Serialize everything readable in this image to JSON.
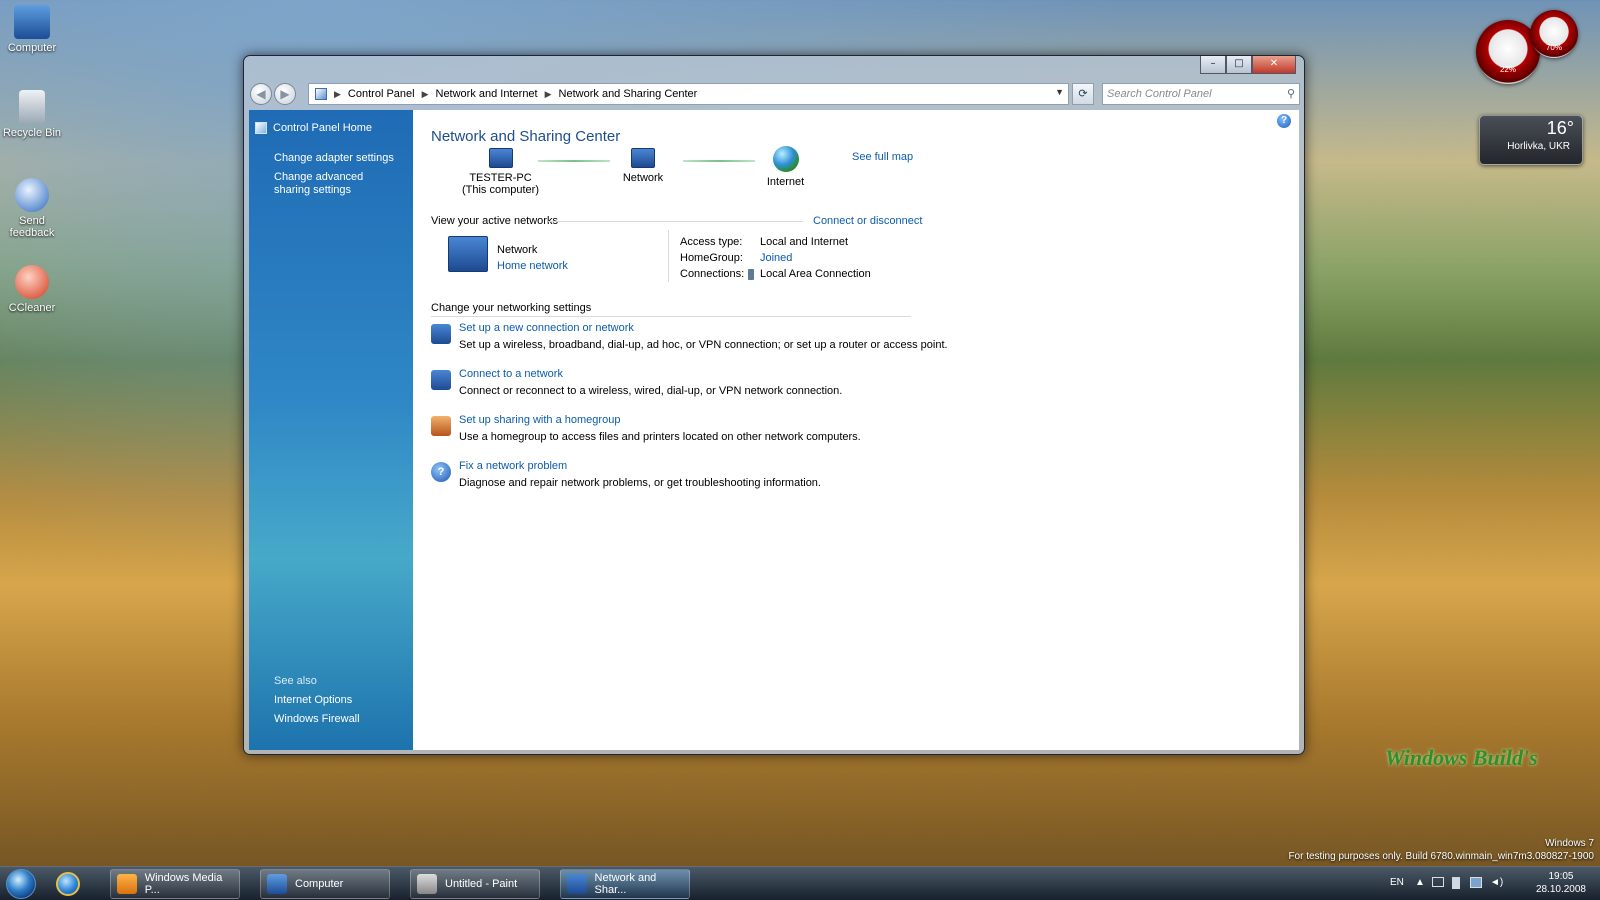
{
  "desktop": {
    "icons": [
      "Computer",
      "Recycle Bin",
      "Send feedback",
      "CCleaner"
    ],
    "meter_cpu": "22%",
    "meter_mem": "70%",
    "weather_temp": "16°",
    "weather_city": "Horlivka, UKR",
    "watermark_line1": "Windows 7",
    "watermark_line2": "For testing purposes only. Build 6780.winmain_win7m3.080827-1900",
    "brand_text": "Windows Build's"
  },
  "window": {
    "breadcrumb": [
      "Control Panel",
      "Network and Internet",
      "Network and Sharing Center"
    ],
    "search_placeholder": "Search Control Panel",
    "sidebar": {
      "home": "Control Panel Home",
      "links": [
        "Change adapter settings",
        "Change advanced sharing settings"
      ],
      "see_also": "See also",
      "see_also_links": [
        "Internet Options",
        "Windows Firewall"
      ]
    },
    "title": "Network and Sharing Center",
    "see_full_map": "See full map",
    "map": {
      "pc_name": "TESTER-PC",
      "pc_sub": "(This computer)",
      "network": "Network",
      "internet": "Internet"
    },
    "active_networks_label": "View your active networks",
    "connect_disconnect": "Connect or disconnect",
    "active_network": {
      "name": "Network",
      "type": "Home network",
      "access_type_label": "Access type:",
      "access_type_value": "Local and Internet",
      "homegroup_label": "HomeGroup:",
      "homegroup_value": "Joined",
      "connections_label": "Connections:",
      "connections_value": "Local Area Connection"
    },
    "change_settings_label": "Change your networking settings",
    "tasks": [
      {
        "title": "Set up a new connection or network",
        "desc": "Set up a wireless, broadband, dial-up, ad hoc, or VPN connection; or set up a router or access point."
      },
      {
        "title": "Connect to a network",
        "desc": "Connect or reconnect to a wireless, wired, dial-up, or VPN network connection."
      },
      {
        "title": "Set up sharing with a homegroup",
        "desc": "Use a homegroup to access files and printers located on other network computers."
      },
      {
        "title": "Fix a network problem",
        "desc": "Diagnose and repair network problems, or get troubleshooting information."
      }
    ]
  },
  "taskbar": {
    "buttons": [
      "Windows Media P...",
      "Computer",
      "Untitled - Paint",
      "Network and Shar..."
    ],
    "lang": "EN",
    "time": "19:05",
    "date": "28.10.2008"
  },
  "colors": {
    "link": "#0b5cab",
    "title": "#1f4e8c",
    "sidebar": "#2f87c6"
  }
}
